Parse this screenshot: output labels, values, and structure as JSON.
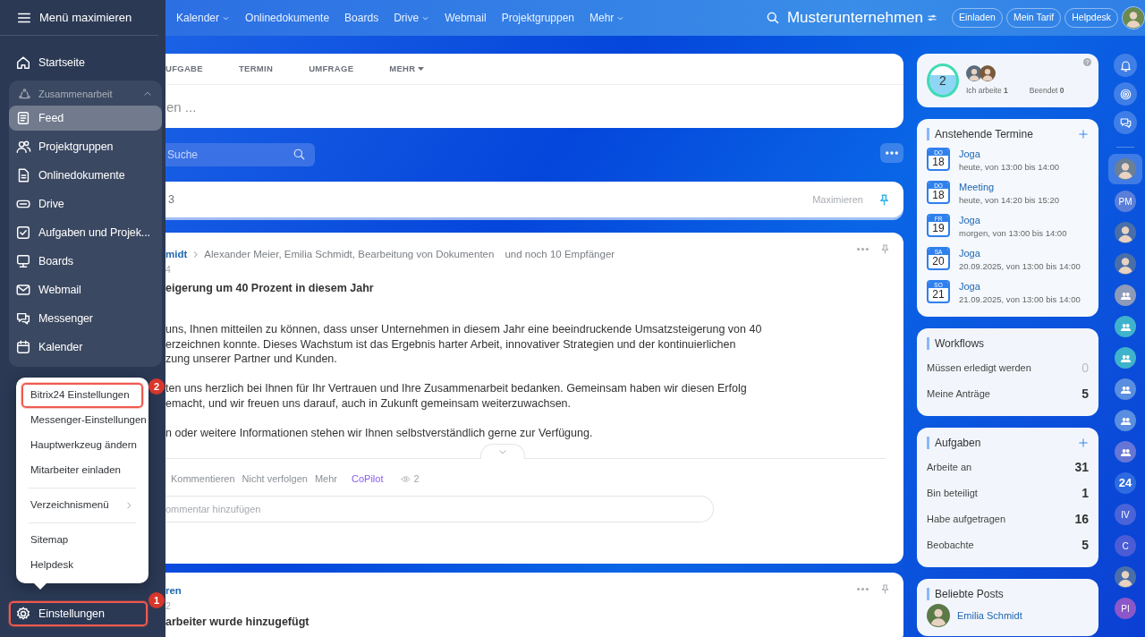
{
  "sidebar": {
    "toggle": "Menü maximieren",
    "home": {
      "label": "Startseite"
    },
    "group": {
      "label": "Zusammenarbeit",
      "expanded": true,
      "items": [
        {
          "label": "Feed",
          "selected": true
        },
        {
          "label": "Projektgruppen",
          "selected": false
        },
        {
          "label": "Onlinedokumente",
          "selected": false
        },
        {
          "label": "Drive",
          "selected": false
        },
        {
          "label": "Aufgaben und Projek...",
          "selected": false
        },
        {
          "label": "Boards",
          "selected": false
        },
        {
          "label": "Webmail",
          "selected": false
        },
        {
          "label": "Messenger",
          "selected": false
        },
        {
          "label": "Kalender",
          "selected": false
        }
      ]
    },
    "settings": {
      "label": "Einstellungen",
      "highlighted": true,
      "callout": "1"
    }
  },
  "settings_menu": {
    "sections": [
      [
        {
          "label": "Bitrix24 Einstellungen",
          "highlighted": true,
          "callout": "2",
          "submenu": false
        },
        {
          "label": "Messenger-Einstellungen",
          "highlighted": false,
          "submenu": false
        },
        {
          "label": "Hauptwerkzeug ändern",
          "highlighted": false,
          "submenu": false
        },
        {
          "label": "Mitarbeiter einladen",
          "highlighted": false,
          "submenu": false
        }
      ],
      [
        {
          "label": "Verzeichnismenü",
          "highlighted": false,
          "submenu": true
        }
      ],
      [
        {
          "label": "Sitemap",
          "highlighted": false,
          "submenu": false
        },
        {
          "label": "Helpdesk",
          "highlighted": false,
          "submenu": false
        }
      ]
    ]
  },
  "top_nav": {
    "links": [
      {
        "label": "Kalender",
        "dropdown": true
      },
      {
        "label": "Onlinedokumente",
        "dropdown": false
      },
      {
        "label": "Boards",
        "dropdown": false
      },
      {
        "label": "Drive",
        "dropdown": true
      },
      {
        "label": "Webmail",
        "dropdown": false
      },
      {
        "label": "Projektgruppen",
        "dropdown": false
      },
      {
        "label": "Mehr",
        "dropdown": true
      }
    ],
    "company": "Musterunternehmen",
    "buttons": [
      "Einladen",
      "Mein Tarif",
      "Helpdesk"
    ]
  },
  "composer": {
    "tabs": [
      {
        "label": "UFGABE",
        "dropdown": false
      },
      {
        "label": "TERMIN",
        "dropdown": false
      },
      {
        "label": "UMFRAGE",
        "dropdown": false
      },
      {
        "label": "MEHR",
        "dropdown": true
      }
    ],
    "placeholder": "en ..."
  },
  "feed_toolbar": {
    "placeholder": "Suche"
  },
  "pinned": {
    "count": "3",
    "action": "Maximieren"
  },
  "posts": [
    {
      "kind": "full",
      "author": "midt",
      "time": "4",
      "recipients": "Alexander Meier, Emilia Schmidt, Bearbeitung von Dokumenten",
      "more_recipients": "und noch 10 Empfänger",
      "title": "eigerung um 40 Prozent in diesem Jahr",
      "paragraphs": [
        [
          "uns, Ihnen mitteilen zu können, dass unser Unternehmen in diesem Jahr eine beeindruckende Umsatzsteigerung von 40",
          "erzeichnen konnte. Dieses Wachstum ist das Ergebnis harter Arbeit, innovativer Strategien und der kontinuierlichen",
          "zung unserer Partner und Kunden."
        ],
        [
          "ten uns herzlich bei Ihnen für Ihr Vertrauen und Ihre Zusammenarbeit bedanken. Gemeinsam haben wir diesen Erfolg",
          "emacht, und wir freuen uns darauf, auch in Zukunft gemeinsam weiterzuwachsen."
        ],
        [
          "n oder weitere Informationen stehen wir Ihnen selbstverständlich gerne zur Verfügung."
        ]
      ],
      "actions": [
        "Kommentieren",
        "Nicht verfolgen",
        "Mehr"
      ],
      "copilot": "CoPilot",
      "views": "2",
      "comment_placeholder": "ommentar hinzufügen"
    },
    {
      "kind": "partial",
      "author": "ren",
      "time": "2",
      "title": "arbeiter wurde hinzugefügt"
    }
  ],
  "timer": {
    "count": "2",
    "help": "?",
    "stats": [
      {
        "label": "Ich arbeite",
        "value": "1"
      },
      {
        "label": "Beendet",
        "value": "0"
      }
    ]
  },
  "events": {
    "title": "Anstehende Termine",
    "items": [
      {
        "weekday": "DO",
        "day": "18",
        "title": "Joga",
        "time": "heute, von 13:00 bis 14:00"
      },
      {
        "weekday": "DO",
        "day": "18",
        "title": "Meeting",
        "time": "heute, von 14:20 bis 15:20"
      },
      {
        "weekday": "FR",
        "day": "19",
        "title": "Joga",
        "time": "morgen, von 13:00 bis 14:00"
      },
      {
        "weekday": "SA",
        "day": "20",
        "title": "Joga",
        "time": "20.09.2025, von 13:00 bis 14:00"
      },
      {
        "weekday": "SO",
        "day": "21",
        "title": "Joga",
        "time": "21.09.2025, von 13:00 bis 14:00"
      }
    ]
  },
  "workflows": {
    "title": "Workflows",
    "rows": [
      {
        "label": "Müssen erledigt werden",
        "value": "0",
        "muted": true
      },
      {
        "label": "Meine Anträge",
        "value": "5",
        "muted": false
      }
    ]
  },
  "tasks": {
    "title": "Aufgaben",
    "rows": [
      {
        "label": "Arbeite an",
        "value": "31"
      },
      {
        "label": "Bin beteiligt",
        "value": "1"
      },
      {
        "label": "Habe aufgetragen",
        "value": "16"
      },
      {
        "label": "Beobachte",
        "value": "5"
      }
    ]
  },
  "popular": {
    "title": "Beliebte Posts",
    "items": [
      {
        "author": "Emilia Schmidt"
      }
    ]
  },
  "rail": {
    "items": [
      {
        "kind": "photo",
        "selected": true
      },
      {
        "kind": "initials",
        "label": "PM",
        "color": "#5b7fd8",
        "selected": false
      },
      {
        "kind": "photo",
        "selected": false
      },
      {
        "kind": "photo",
        "selected": false
      },
      {
        "kind": "group",
        "color": "#8d9ab9",
        "selected": false
      },
      {
        "kind": "group",
        "color": "#3fb3cb",
        "selected": false
      },
      {
        "kind": "group",
        "color": "#3fb3cb",
        "selected": false
      },
      {
        "kind": "group",
        "color": "#5a8ee0",
        "selected": false
      },
      {
        "kind": "group",
        "color": "#5a8ee0",
        "selected": false
      },
      {
        "kind": "group",
        "color": "#6676d6",
        "selected": false
      },
      {
        "kind": "logo",
        "label": "24",
        "color": "#2f6be0",
        "selected": false
      },
      {
        "kind": "initials",
        "label": "IV",
        "color": "#4b63d9",
        "selected": false
      },
      {
        "kind": "initials",
        "label": "C",
        "color": "#4b5cd6",
        "selected": false
      },
      {
        "kind": "photo",
        "selected": false
      },
      {
        "kind": "initials",
        "label": "PI",
        "color": "#8b57c9",
        "selected": false
      }
    ]
  }
}
